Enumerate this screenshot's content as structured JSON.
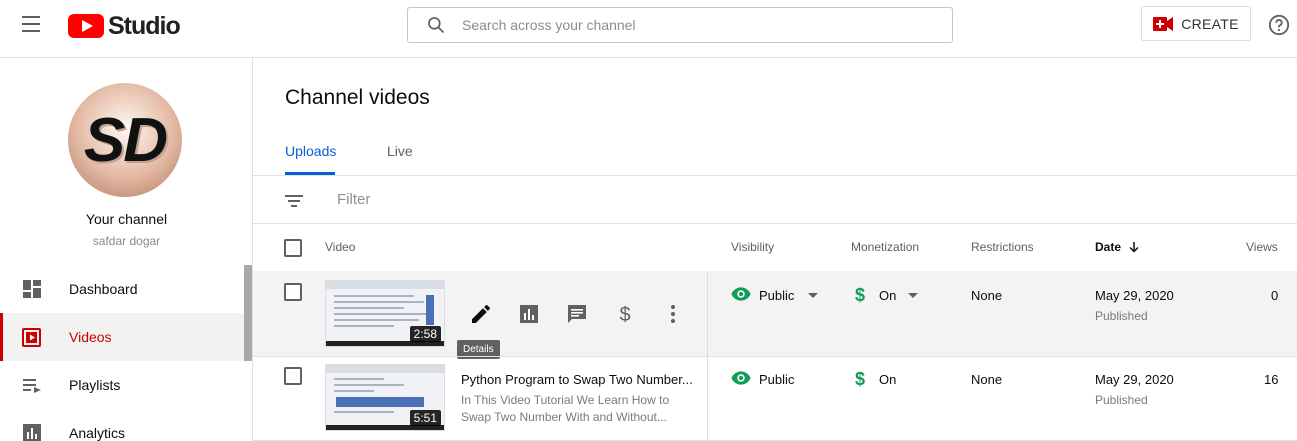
{
  "app": {
    "logo_text": "Studio",
    "search_placeholder": "Search across your channel",
    "create_label": "CREATE"
  },
  "colors": {
    "accent_blue": "#065fd4",
    "active_red": "#cc0000",
    "logo_red": "#ff0000",
    "public_green": "#0f9d58",
    "money_green": "#0f9d58"
  },
  "sidebar": {
    "avatar_initials": "SD",
    "your_channel_label": "Your channel",
    "channel_name": "safdar dogar",
    "items": [
      {
        "label": "Dashboard",
        "icon": "dashboard-icon"
      },
      {
        "label": "Videos",
        "icon": "videos-icon",
        "active": true
      },
      {
        "label": "Playlists",
        "icon": "playlists-icon"
      },
      {
        "label": "Analytics",
        "icon": "analytics-icon"
      }
    ]
  },
  "main": {
    "title": "Channel videos",
    "tabs": [
      {
        "label": "Uploads",
        "active": true
      },
      {
        "label": "Live",
        "active": false
      }
    ],
    "filter_label": "Filter",
    "columns": {
      "video": "Video",
      "visibility": "Visibility",
      "monetization": "Monetization",
      "restrictions": "Restrictions",
      "date": "Date",
      "views": "Views"
    },
    "tooltip": "Details",
    "rows": [
      {
        "duration": "2:58",
        "visibility": "Public",
        "monetization": "On",
        "restrictions": "None",
        "date": "May 29, 2020",
        "date_status": "Published",
        "views": "0"
      },
      {
        "duration": "5:51",
        "title": "Python Program to Swap Two Number...",
        "description": "In This Video Tutorial We Learn How to Swap Two Number With and Without...",
        "visibility": "Public",
        "monetization": "On",
        "restrictions": "None",
        "date": "May 29, 2020",
        "date_status": "Published",
        "views": "16"
      }
    ]
  }
}
